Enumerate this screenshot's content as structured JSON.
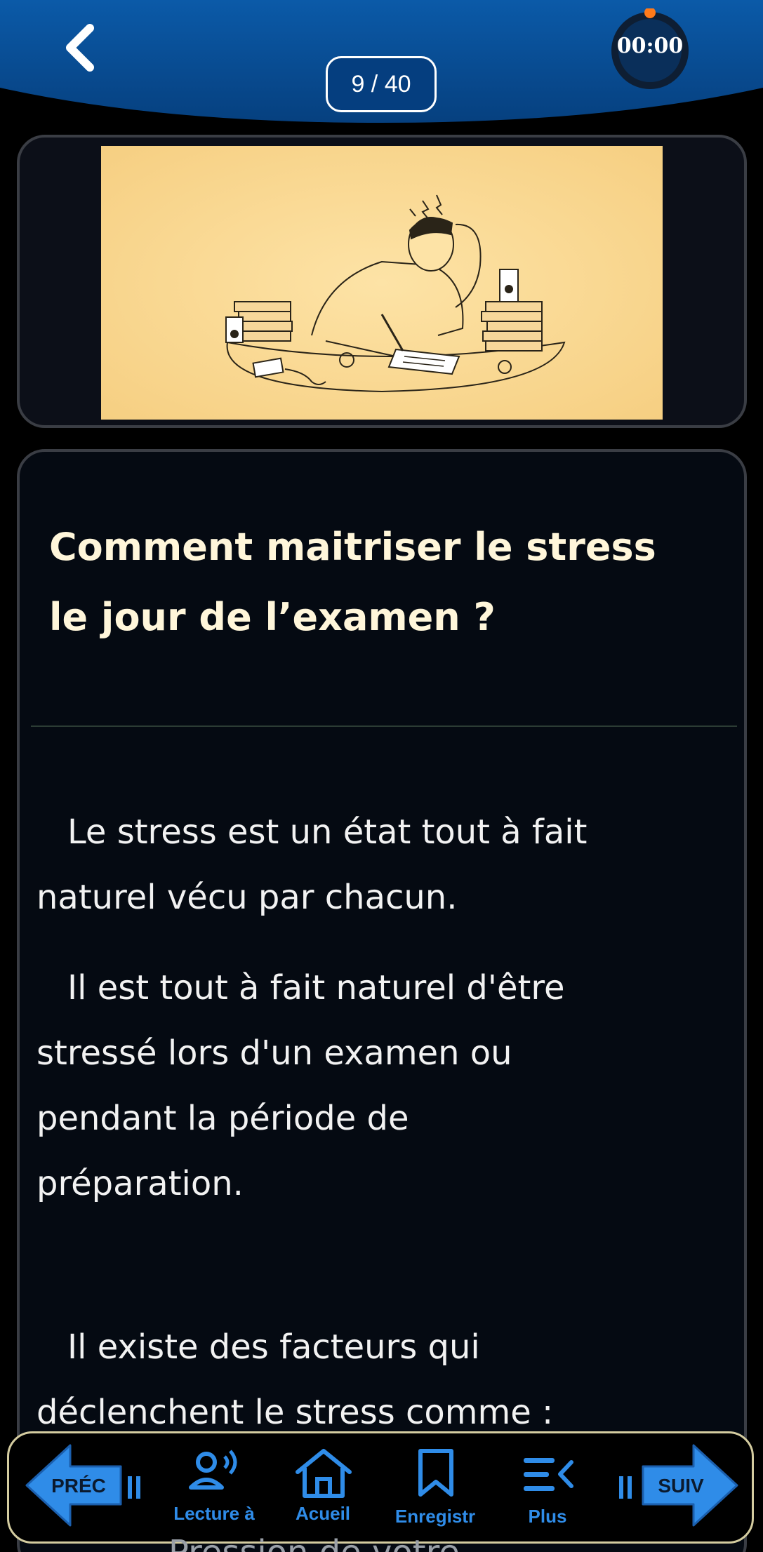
{
  "header": {
    "counter": "9 / 40",
    "timer": "00:00",
    "colors": {
      "bar": "#0b5aa8",
      "timer_dot": "#ff7a1a"
    }
  },
  "illustration": {
    "description_icon": "stressed-student-illustration"
  },
  "content": {
    "title_lines": [
      "Comment maitriser le stress",
      "le jour de l’examen ?"
    ],
    "paragraph1_lines": [
      "Le stress est un état tout à fait",
      "naturel vécu par chacun."
    ],
    "paragraph2_lines": [
      "Il est tout à fait naturel d'être",
      "stressé lors d'un examen ou",
      "pendant la période de",
      "préparation."
    ],
    "paragraph3_lines": [
      "Il existe des facteurs qui",
      "déclenchent le stress comme :"
    ],
    "peek_text": "Pression de votre"
  },
  "nav": {
    "prev": "PRÉC",
    "next": "SUIV",
    "items": [
      {
        "label": "Lecture à",
        "icon": "read-aloud-icon"
      },
      {
        "label": "Acueil",
        "icon": "home-icon"
      },
      {
        "label": "Enregistr",
        "icon": "bookmark-icon"
      },
      {
        "label": "Plus",
        "icon": "menu-more-icon"
      }
    ]
  }
}
